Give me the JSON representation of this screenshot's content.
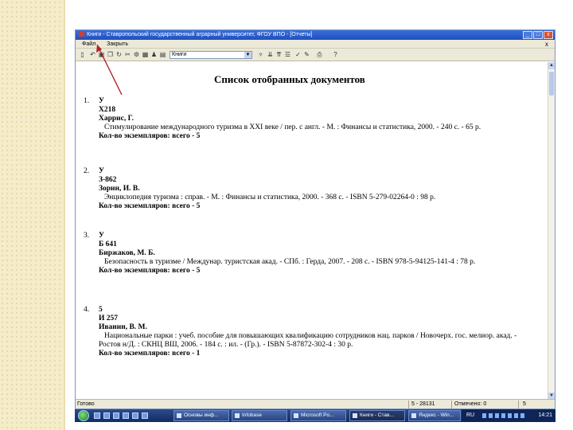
{
  "window": {
    "title": "Книги - Ставропольский государственный аграрный университет, ФГОУ ВПО - [Отчеты]",
    "controls": {
      "min": "_",
      "max": "□",
      "close": "x"
    }
  },
  "menu": {
    "file": "Файл",
    "close": "Закрыть",
    "doc_close": "x"
  },
  "toolbar": {
    "combo_value": "Книги",
    "combo_arrow": "▼"
  },
  "report": {
    "title": "Список отобранных документов",
    "entries": [
      {
        "num": "1.",
        "code1": "У",
        "code2": "Х218",
        "author": "Харрис, Г.",
        "desc": "Стимулирование международного туризма в XXI веке / пер. с англ. - М. : Финансы и статистика, 2000. - 240 с. - 65 р.",
        "copies": "Кол-во экземпляров: всего - 5"
      },
      {
        "num": "2.",
        "code1": "У",
        "code2": "З-862",
        "author": "Зорин, И. В.",
        "desc": "Энциклопедия туризма : справ. - М. : Финансы и статистика, 2000. - 368 с. - ISBN 5-279-02264-0 : 98 р.",
        "copies": "Кол-во экземпляров: всего - 5"
      },
      {
        "num": "3.",
        "code1": "У",
        "code2": "Б 641",
        "author": "Биржаков, М. Б.",
        "desc": "Безопасность в туризме / Междунар. туристская акад. - СПб. : Герда, 2007. - 208 с. - ISBN 978-5-94125-141-4 : 78 р.",
        "copies": "Кол-во экземпляров: всего - 5"
      },
      {
        "num": "4.",
        "code1": "5",
        "code2": "И 257",
        "author": "Иванин, В. М.",
        "desc": "Национальные парки : учеб. пособие для повышающих квалификацию сотрудников нац. парков / Новочерх. гос. мелиор. акад. - Ростов н/Д. : СКНЦ ВШ, 2006. - 184 с. : ил. - (Гр.). - ISBN 5-87872-302-4 : 30 р.",
        "copies": "Кол-во экземпляров: всего - 1"
      }
    ]
  },
  "status": {
    "ready": "Готово",
    "page": "5 - 28131",
    "marked": "Отмечено: 0",
    "count": "5"
  },
  "taskbar": {
    "buttons": [
      "Основы инф...",
      "Infobase",
      "Microsoft Po...",
      "Книги - Став...",
      "Яндекс - Win..."
    ],
    "lang": "RU",
    "clock": "14:21"
  },
  "colors": {
    "titlebar": "#1f4fbf",
    "annotation_arrow": "#b0232a",
    "left_pattern": "#f5ecc9"
  }
}
